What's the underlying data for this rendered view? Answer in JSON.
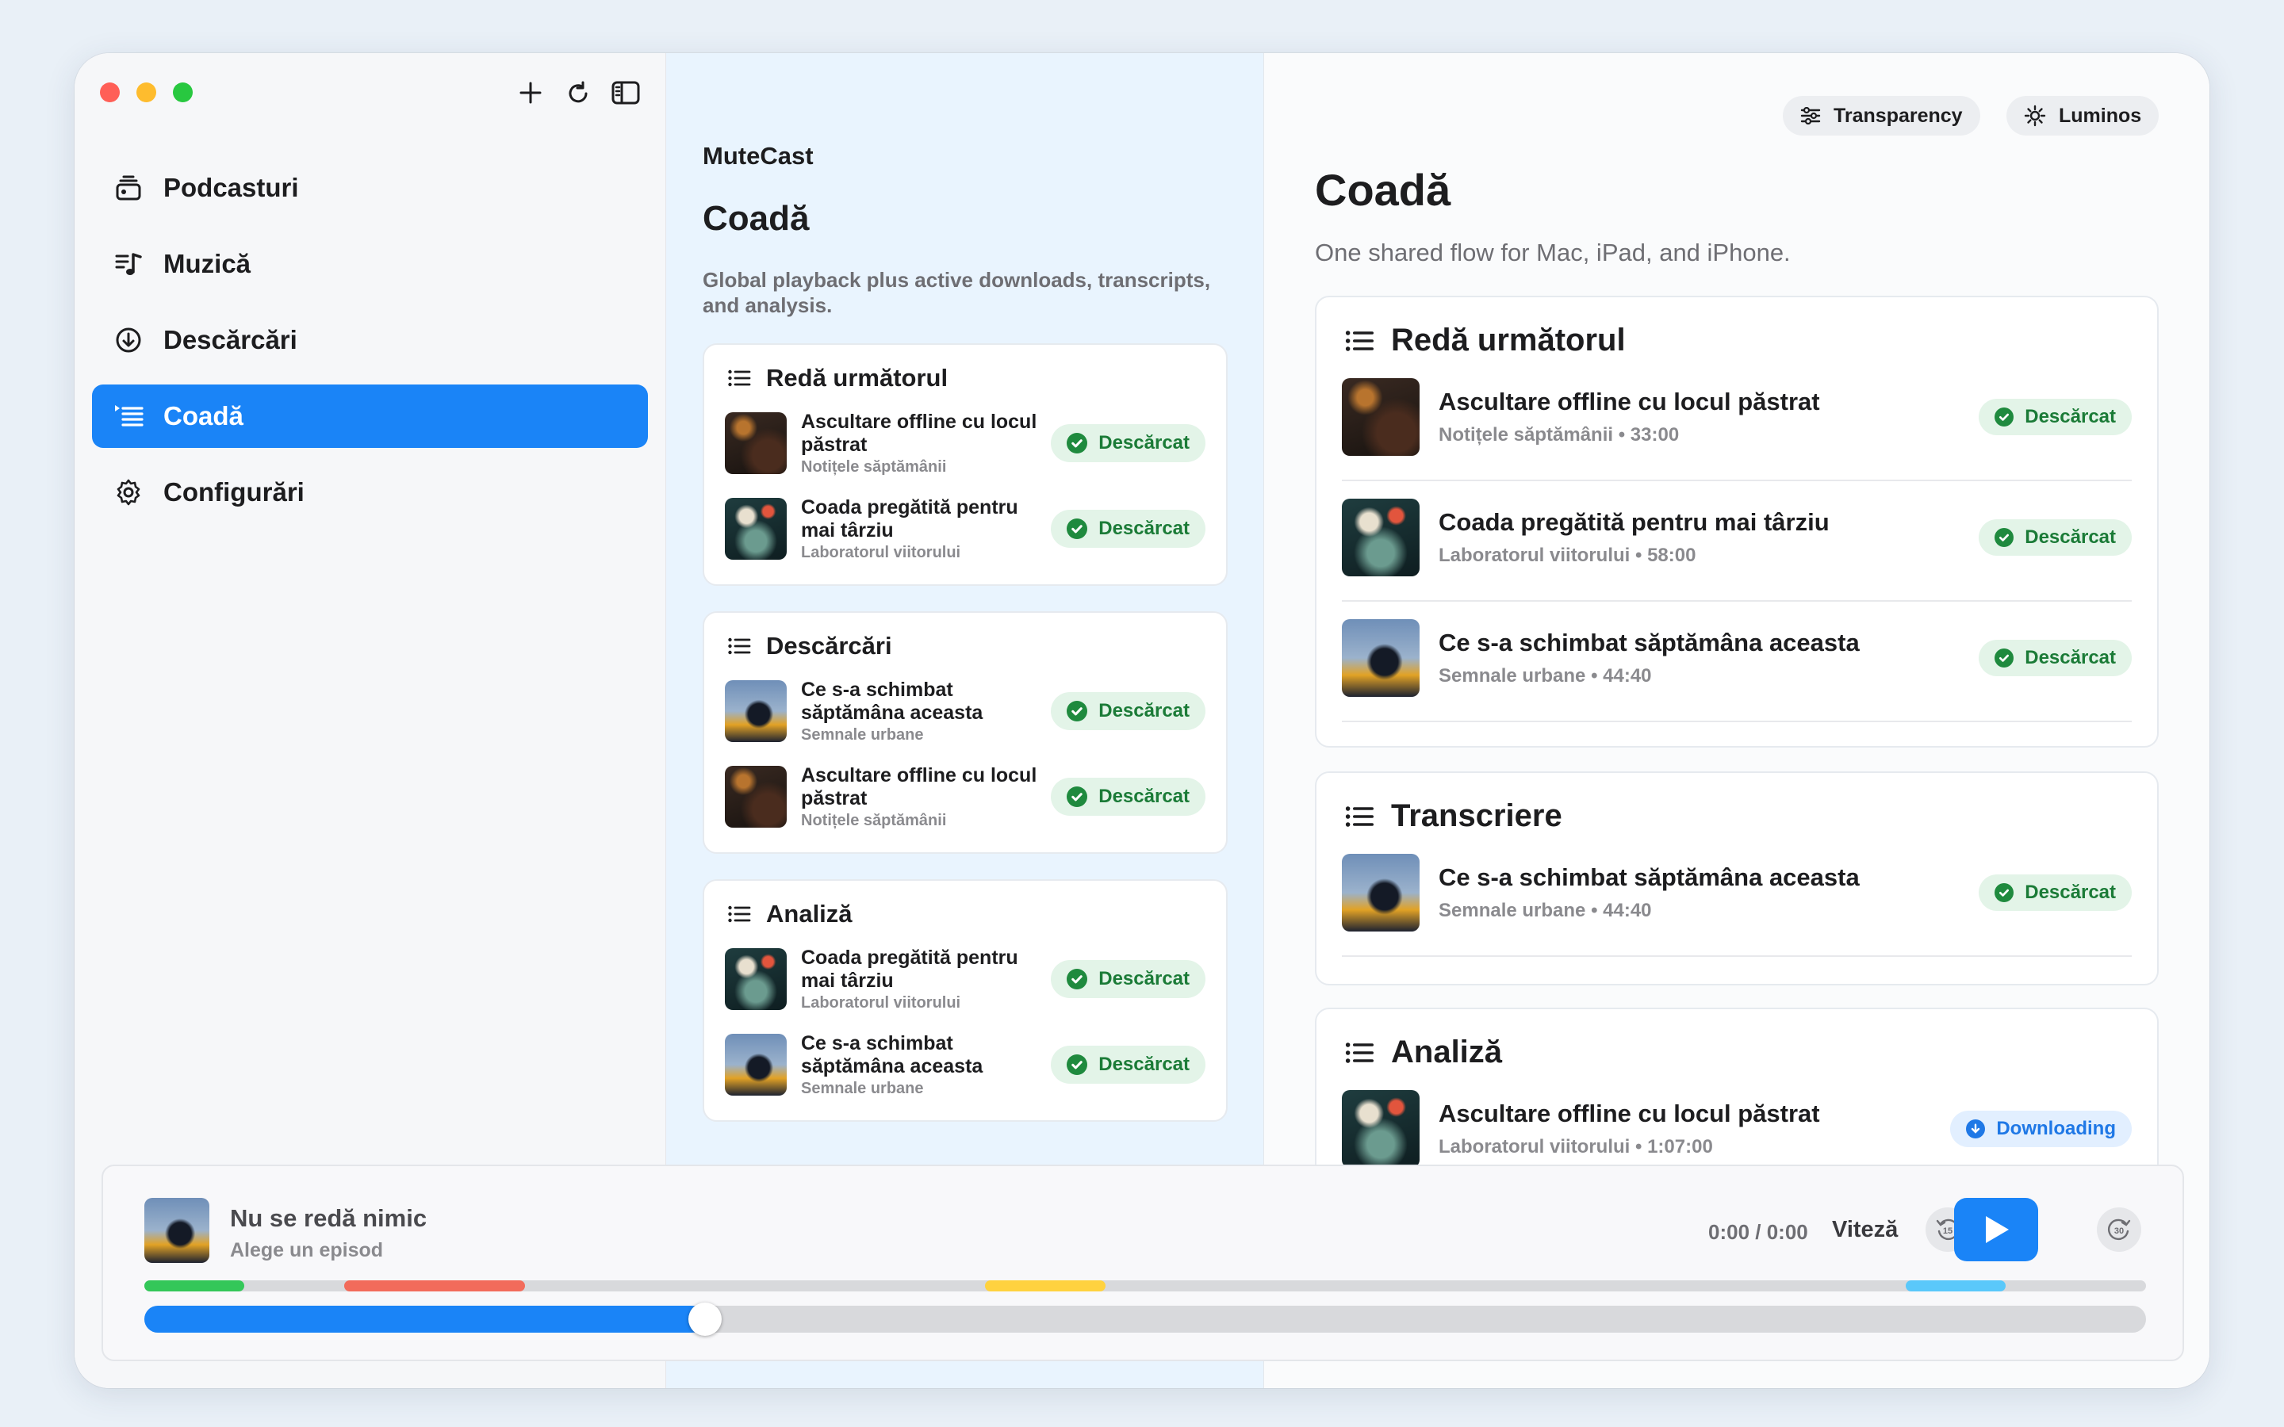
{
  "sidebar": {
    "items": [
      {
        "label": "Podcasturi",
        "icon": "podcast-stack-icon"
      },
      {
        "label": "Muzică",
        "icon": "music-note-icon"
      },
      {
        "label": "Descărcări",
        "icon": "download-circle-icon"
      },
      {
        "label": "Coadă",
        "icon": "queue-list-icon"
      },
      {
        "label": "Configurări",
        "icon": "gear-icon"
      }
    ],
    "active_label": "Coadă"
  },
  "middle": {
    "app_name": "MuteCast",
    "title": "Coadă",
    "description": "Global playback plus active downloads, transcripts, and analysis.",
    "sections": [
      {
        "title": "Redă următorul",
        "rows": [
          {
            "title": "Ascultare offline cu locul păstrat",
            "sub": "Notițele săptămânii",
            "badge": "Descărcat",
            "art": "room"
          },
          {
            "title": "Coada pregătită pentru mai târziu",
            "sub": "Laboratorul viitorului",
            "badge": "Descărcat",
            "art": "globe"
          }
        ]
      },
      {
        "title": "Descărcări",
        "rows": [
          {
            "title": "Ce s-a schimbat săptămâna aceasta",
            "sub": "Semnale urbane",
            "badge": "Descărcat",
            "art": "city"
          },
          {
            "title": "Ascultare offline cu locul păstrat",
            "sub": "Notițele săptămânii",
            "badge": "Descărcat",
            "art": "room"
          }
        ]
      },
      {
        "title": "Analiză",
        "rows": [
          {
            "title": "Coada pregătită pentru mai târziu",
            "sub": "Laboratorul viitorului",
            "badge": "Descărcat",
            "art": "globe"
          },
          {
            "title": "Ce s-a schimbat săptămâna aceasta",
            "sub": "Semnale urbane",
            "badge": "Descărcat",
            "art": "city"
          }
        ]
      }
    ]
  },
  "right": {
    "pills": {
      "transparency": "Transparency",
      "theme": "Luminos"
    },
    "title": "Coadă",
    "description": "One shared flow for Mac, iPad, and iPhone.",
    "sections": [
      {
        "title": "Redă următorul",
        "rows": [
          {
            "title": "Ascultare offline cu locul păstrat",
            "sub": "Notițele săptămânii • 33:00",
            "badge": "Descărcat",
            "state": "done",
            "art": "room"
          },
          {
            "title": "Coada pregătită pentru mai târziu",
            "sub": "Laboratorul viitorului • 58:00",
            "badge": "Descărcat",
            "state": "done",
            "art": "globe"
          },
          {
            "title": "Ce s-a schimbat săptămâna aceasta",
            "sub": "Semnale urbane • 44:40",
            "badge": "Descărcat",
            "state": "done",
            "art": "city"
          }
        ]
      },
      {
        "title": "Transcriere",
        "rows": [
          {
            "title": "Ce s-a schimbat săptămâna aceasta",
            "sub": "Semnale urbane • 44:40",
            "badge": "Descărcat",
            "state": "done",
            "art": "city"
          }
        ]
      },
      {
        "title": "Analiză",
        "rows": [
          {
            "title": "Ascultare offline cu locul păstrat",
            "sub": "Laboratorul viitorului • 1:07:00",
            "badge": "Downloading",
            "state": "downloading",
            "art": "globe"
          }
        ]
      }
    ]
  },
  "player": {
    "title": "Nu se redă nimic",
    "subtitle": "Alege un episod",
    "time": "0:00 / 0:00",
    "speed_label": "Viteză",
    "progress": 0.28,
    "segments": [
      {
        "start": 0.0,
        "end": 0.05,
        "color": "#34c759"
      },
      {
        "start": 0.1,
        "end": 0.19,
        "color": "#f26b5b"
      },
      {
        "start": 0.42,
        "end": 0.48,
        "color": "#ffd23f"
      },
      {
        "start": 0.88,
        "end": 0.93,
        "color": "#5ac8fa"
      }
    ],
    "skip_back_label": "15",
    "skip_forward_label": "30"
  },
  "colors": {
    "accent": "#1a84f7",
    "success": "#1f8a3e",
    "success_bg": "#e3f4e8"
  }
}
